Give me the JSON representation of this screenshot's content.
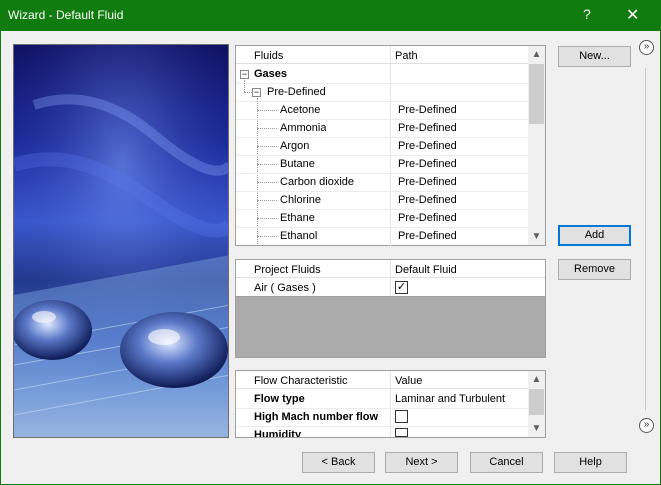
{
  "window": {
    "title": "Wizard - Default Fluid",
    "help_label": "?",
    "close_label": "✕"
  },
  "fluids_grid": {
    "headers": {
      "fluids": "Fluids",
      "path": "Path"
    },
    "group": "Gases",
    "subgroup": "Pre-Defined",
    "rows": [
      {
        "name": "Acetone",
        "path": "Pre-Defined"
      },
      {
        "name": "Ammonia",
        "path": "Pre-Defined"
      },
      {
        "name": "Argon",
        "path": "Pre-Defined"
      },
      {
        "name": "Butane",
        "path": "Pre-Defined"
      },
      {
        "name": "Carbon dioxide",
        "path": "Pre-Defined"
      },
      {
        "name": "Chlorine",
        "path": "Pre-Defined"
      },
      {
        "name": "Ethane",
        "path": "Pre-Defined"
      },
      {
        "name": "Ethanol",
        "path": "Pre-Defined"
      }
    ],
    "expander_minus": "−"
  },
  "project_grid": {
    "headers": {
      "project_fluids": "Project Fluids",
      "default_fluid": "Default Fluid"
    },
    "rows": [
      {
        "name": "Air ( Gases )",
        "default": "✓"
      }
    ]
  },
  "flow_grid": {
    "headers": {
      "characteristic": "Flow Characteristic",
      "value": "Value"
    },
    "rows": [
      {
        "name": "Flow type",
        "value": "Laminar and Turbulent"
      },
      {
        "name": "High Mach number flow",
        "value": ""
      },
      {
        "name": "Humidity",
        "value": ""
      }
    ]
  },
  "side_buttons": {
    "new": "New...",
    "add": "Add",
    "remove": "Remove",
    "expand_top": "»",
    "expand_bottom": "»"
  },
  "footer": {
    "back": "< Back",
    "next": "Next >",
    "cancel": "Cancel",
    "help": "Help"
  },
  "scroll_arrows": {
    "up": "▲",
    "down": "▼"
  }
}
